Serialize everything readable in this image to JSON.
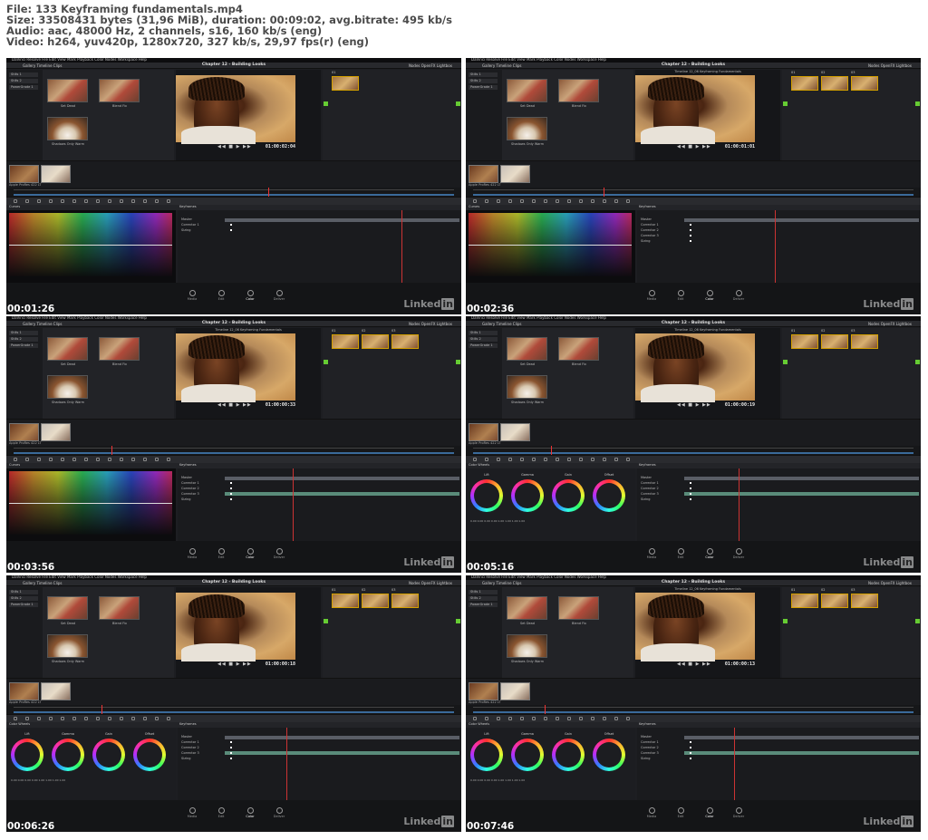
{
  "header": {
    "file_line": "File: 133 Keyframing fundamentals.mp4",
    "size_line": "Size: 33508431 bytes (31,96 MiB), duration: 00:09:02, avg.bitrate: 495 kb/s",
    "audio_line": "Audio: aac, 48000 Hz, 2 channels, s16, 160 kb/s (eng)",
    "video_line": "Video: h264, yuv420p, 1280x720, 327 kb/s, 29,97 fps(r) (eng)"
  },
  "app": {
    "menu": "DaVinci Resolve   File   Edit   View   Mark   Playback   Color   Nodes   Workspace   Help",
    "title": "Chapter 12 - Building Looks",
    "toolbar_left": "Gallery    Timeline    Clips",
    "toolbar_right": "Nodes    OpenFX    Lightbox",
    "gallery_side": [
      "Stills 1",
      "Stills 2",
      "PowerGrade 1"
    ],
    "stills": [
      "Set Dead",
      "Blend Fix",
      "Shadows Only Warm"
    ],
    "clip_info": "Apple ProRes 422 LT",
    "watermark": "Linked",
    "watermark_badge": "in",
    "pages": [
      "Media",
      "Edit",
      "Color",
      "Deliver"
    ],
    "wheel_labels": [
      "Lift",
      "Gamma",
      "Gain",
      "Offset"
    ],
    "wheel_values": "0.00  0.00  0.00  0.00    1.00  1.00  1.00  1.00",
    "curves_label": "Curves",
    "color_wheels_label": "Color Wheels",
    "keyframes_label": "Keyframes"
  },
  "frames": [
    {
      "timestamp": "00:01:26",
      "timecode": "01:00:02:04",
      "viewer_title": "",
      "panel": "curves",
      "nodes": 1,
      "kf_rows": [
        "Master",
        "Corrector 1",
        "Sizing"
      ],
      "playhead": 0.78
    },
    {
      "timestamp": "00:02:36",
      "timecode": "01:00:01:01",
      "viewer_title": "Timeline 12_06 Keyframing Fundamentals",
      "panel": "curves",
      "nodes": 3,
      "kf_rows": [
        "Master",
        "Corrector 1",
        "Corrector 2",
        "Corrector 3",
        "Sizing"
      ],
      "playhead": 0.4
    },
    {
      "timestamp": "00:03:56",
      "timecode": "01:00:00:33",
      "viewer_title": "Timeline 12_06 Keyframing Fundamentals",
      "panel": "curves",
      "nodes": 3,
      "kf_rows": [
        "Master",
        "Corrector 1",
        "Corrector 2",
        "Corrector 3",
        "Sizing"
      ],
      "playhead": 0.3
    },
    {
      "timestamp": "00:05:16",
      "timecode": "01:00:00:19",
      "viewer_title": "Timeline 12_06 Keyframing Fundamentals",
      "panel": "wheels",
      "nodes": 3,
      "kf_rows": [
        "Master",
        "Corrector 1",
        "Corrector 2",
        "Corrector 3",
        "Sizing"
      ],
      "playhead": 0.24
    },
    {
      "timestamp": "00:06:26",
      "timecode": "01:00:00:18",
      "viewer_title": "",
      "panel": "wheels",
      "nodes": 3,
      "kf_rows": [
        "Master",
        "Corrector 1",
        "Corrector 2",
        "Corrector 3",
        "Sizing"
      ],
      "playhead": 0.27
    },
    {
      "timestamp": "00:07:46",
      "timecode": "01:00:00:13",
      "viewer_title": "Timeline 12_06 Keyframing Fundamentals",
      "panel": "wheels",
      "nodes": 3,
      "kf_rows": [
        "Master",
        "Corrector 1",
        "Corrector 2",
        "Corrector 3",
        "Sizing"
      ],
      "playhead": 0.22
    }
  ],
  "colors": {
    "accent_playhead": "#e33333",
    "node_border": "#d4a000",
    "keyframe_track": "#5a8c7a",
    "timeline_bar": "#3a6a9a"
  }
}
